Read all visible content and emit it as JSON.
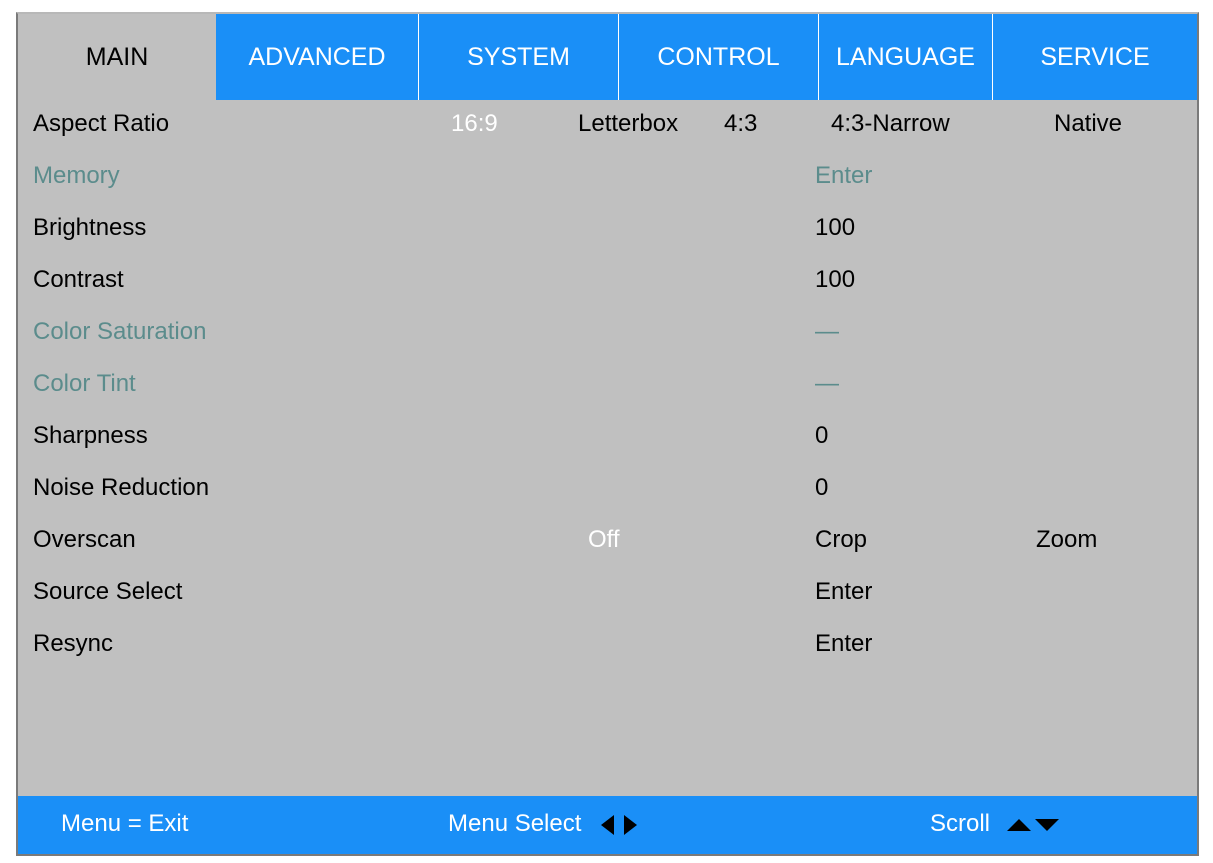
{
  "tabs": [
    {
      "label": "MAIN",
      "active": true
    },
    {
      "label": "ADVANCED"
    },
    {
      "label": "SYSTEM"
    },
    {
      "label": "CONTROL"
    },
    {
      "label": "LANGUAGE"
    },
    {
      "label": "SERVICE"
    }
  ],
  "rows": {
    "aspect_ratio": {
      "label": "Aspect Ratio",
      "options": [
        "16:9",
        "Letterbox",
        "4:3",
        "4:3-Narrow",
        "Native"
      ],
      "selected": "16:9"
    },
    "memory": {
      "label": "Memory",
      "value": "Enter",
      "disabled": true
    },
    "brightness": {
      "label": "Brightness",
      "value": "100"
    },
    "contrast": {
      "label": "Contrast",
      "value": "100"
    },
    "color_saturation": {
      "label": "Color Saturation",
      "value": "—",
      "disabled": true
    },
    "color_tint": {
      "label": "Color Tint",
      "value": "—",
      "disabled": true
    },
    "sharpness": {
      "label": "Sharpness",
      "value": "0"
    },
    "noise_reduction": {
      "label": "Noise Reduction",
      "value": "0"
    },
    "overscan": {
      "label": "Overscan",
      "options": [
        "Off",
        "Crop",
        "Zoom"
      ],
      "selected": "Off"
    },
    "source_select": {
      "label": "Source Select",
      "value": "Enter"
    },
    "resync": {
      "label": "Resync",
      "value": "Enter"
    }
  },
  "footer": {
    "exit_hint": "Menu = Exit",
    "select_hint": "Menu Select",
    "scroll_hint": "Scroll"
  },
  "colors": {
    "menu_bg": "#c0c0c0",
    "accent_blue": "#1a8ff7",
    "disabled_text": "#5b8c8c",
    "selected_text": "#ffffff"
  },
  "icons": {
    "select": [
      "triangle-left-icon",
      "triangle-right-icon"
    ],
    "scroll": [
      "triangle-up-icon",
      "triangle-down-icon"
    ]
  }
}
